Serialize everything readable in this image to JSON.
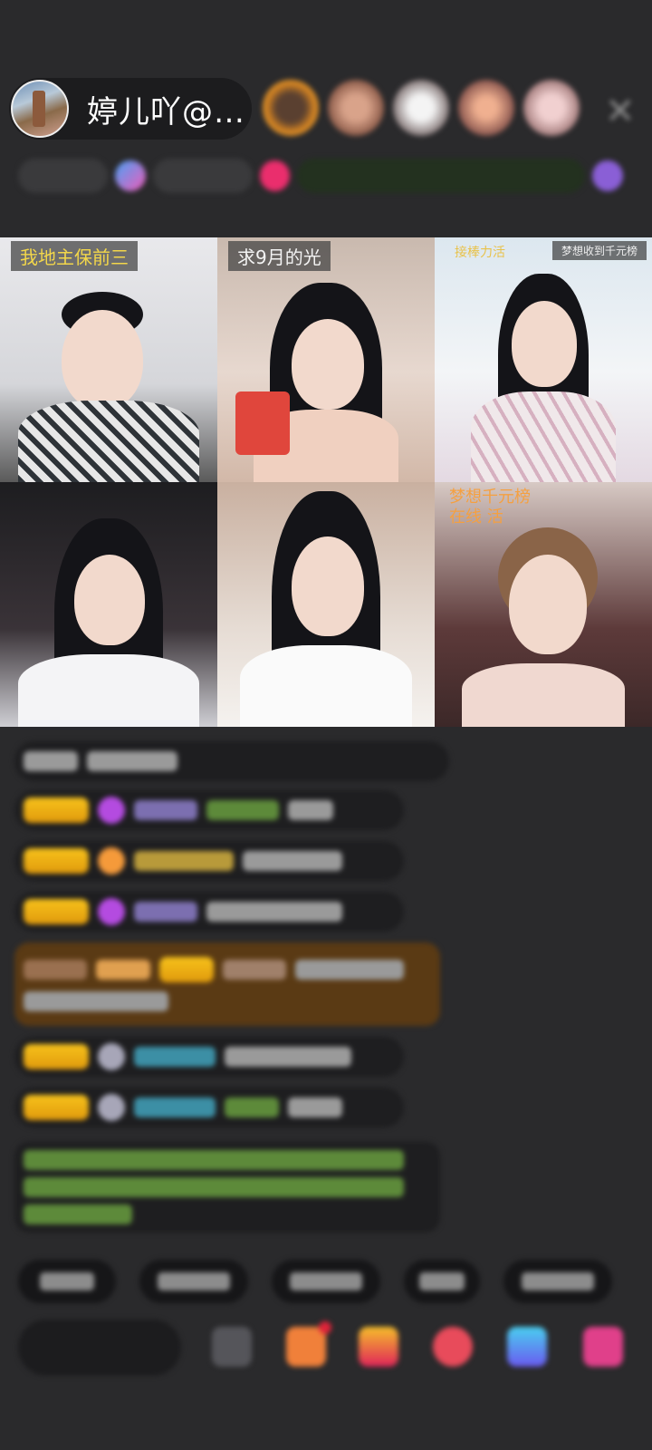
{
  "host": {
    "name": "婷儿吖@…",
    "avatar_icon": "host-avatar"
  },
  "viewers": [
    "viewer-1",
    "viewer-2",
    "viewer-3",
    "viewer-4",
    "viewer-5"
  ],
  "close_icon": "close-icon",
  "grid": {
    "cells": [
      {
        "label": "我地主保前三"
      },
      {
        "label": "求9月的光"
      },
      {
        "label": "接棒力活",
        "label2": "梦想收到千元榜"
      },
      {
        "label": ""
      },
      {
        "label": ""
      },
      {
        "label": "梦想千元榜\n在线 活"
      }
    ]
  }
}
